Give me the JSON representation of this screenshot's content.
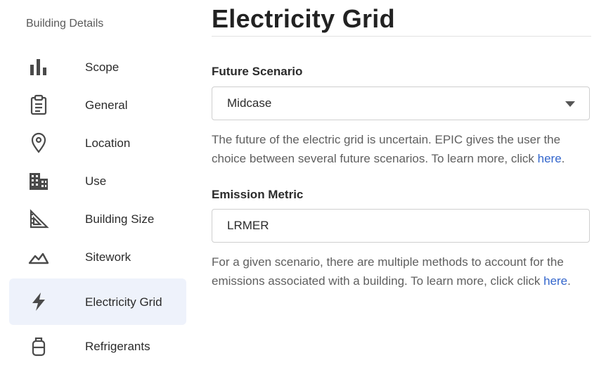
{
  "sidebar": {
    "title": "Building Details",
    "items": [
      {
        "label": "Scope",
        "icon": "bar-chart-icon"
      },
      {
        "label": "General",
        "icon": "clipboard-icon"
      },
      {
        "label": "Location",
        "icon": "map-pin-icon"
      },
      {
        "label": "Use",
        "icon": "building-icon"
      },
      {
        "label": "Building Size",
        "icon": "set-square-icon"
      },
      {
        "label": "Sitework",
        "icon": "terrain-icon"
      },
      {
        "label": "Electricity Grid",
        "icon": "lightning-icon",
        "active": true
      },
      {
        "label": "Refrigerants",
        "icon": "canister-icon"
      }
    ]
  },
  "main": {
    "title": "Electricity Grid",
    "future_scenario": {
      "label": "Future Scenario",
      "value": "Midcase",
      "help_text": "The future of the electric grid is uncertain. EPIC gives the user the choice between several future scenarios. To learn more, click ",
      "help_link": "here",
      "help_end": "."
    },
    "emission_metric": {
      "label": "Emission Metric",
      "value": "LRMER",
      "help_text": "For a given scenario, there are multiple methods to account for the emissions associated with a building. To learn more, click click ",
      "help_link": "here",
      "help_end": "."
    }
  },
  "colors": {
    "accent": "#3366cc",
    "active_bg": "#eef2fb",
    "icon": "#4a4a4a"
  }
}
